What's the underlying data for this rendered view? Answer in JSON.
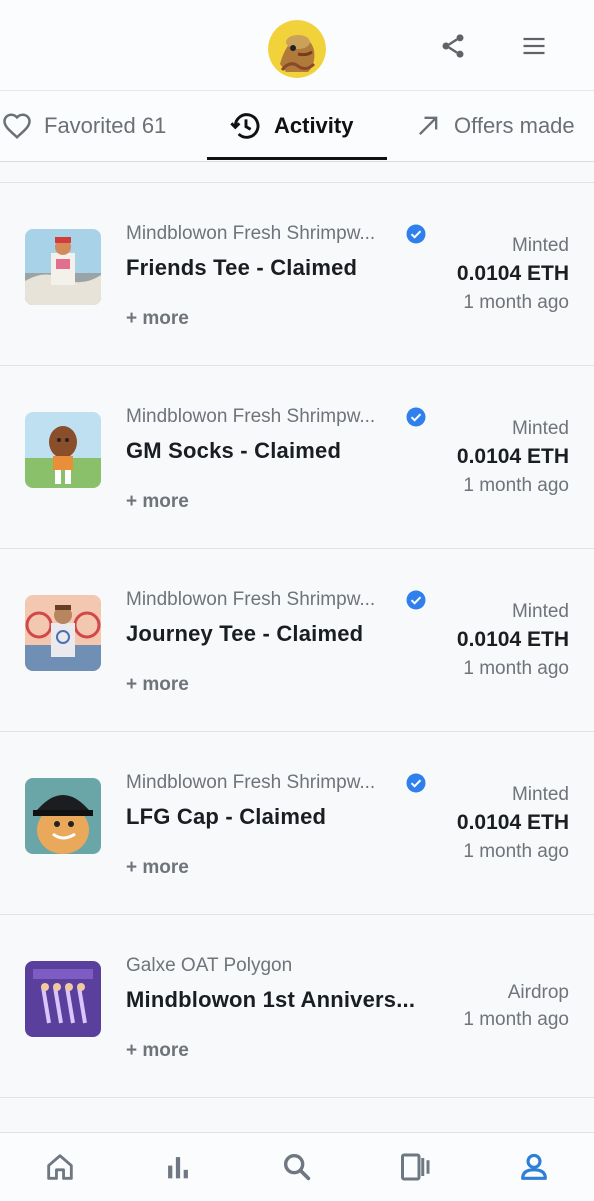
{
  "header": {
    "avatar_alt": "profile avatar",
    "share_icon": "share-icon",
    "menu_icon": "menu-icon"
  },
  "tabs": [
    {
      "label": "Favorited 61",
      "icon": "heart-icon"
    },
    {
      "label": "Activity",
      "icon": "history-icon"
    },
    {
      "label": "Offers made",
      "icon": "arrow-up-right-icon"
    }
  ],
  "activity": [
    {
      "collection": "Mindblowon Fresh Shrimpw...",
      "title": "Friends Tee - Claimed",
      "more": "+ more",
      "type": "Minted",
      "price": "0.0104 ETH",
      "time": "1 month ago"
    },
    {
      "collection": "Mindblowon Fresh Shrimpw...",
      "title": "GM Socks - Claimed",
      "more": "+ more",
      "type": "Minted",
      "price": "0.0104 ETH",
      "time": "1 month ago"
    },
    {
      "collection": "Mindblowon Fresh Shrimpw...",
      "title": "Journey Tee - Claimed",
      "more": "+ more",
      "type": "Minted",
      "price": "0.0104 ETH",
      "time": "1 month ago"
    },
    {
      "collection": "Mindblowon Fresh Shrimpw...",
      "title": "LFG Cap - Claimed",
      "more": "+ more",
      "type": "Minted",
      "price": "0.0104 ETH",
      "time": "1 month ago"
    },
    {
      "collection": "Galxe OAT Polygon",
      "title": "Mindblowon 1st Annivers...",
      "more": "+ more",
      "type": "Airdrop",
      "time": "1 month ago"
    }
  ],
  "bottom_nav": [
    "home-icon",
    "stats-icon",
    "search-icon",
    "cards-icon",
    "profile-icon"
  ],
  "colors": {
    "verified": "#2f80ed",
    "active_nav": "#2f7fd8",
    "inactive_nav": "#6f7782"
  }
}
